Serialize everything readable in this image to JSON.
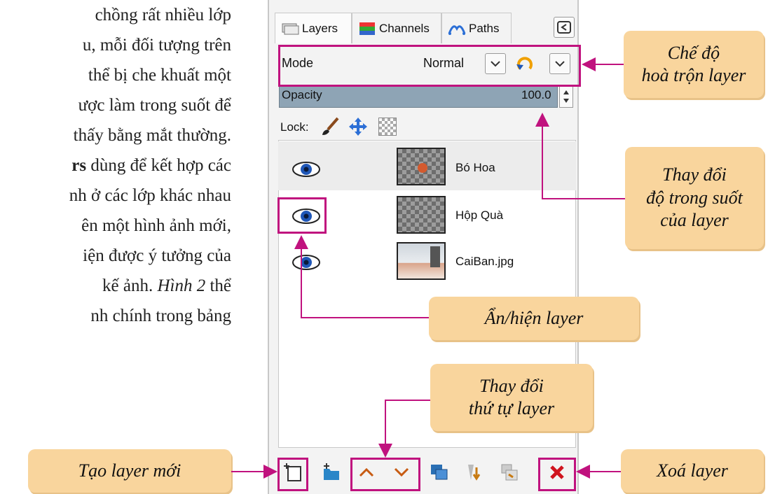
{
  "body_text": {
    "lines": [
      "chồng rất nhiều lớp",
      "u, mỗi đối tượng trên",
      "thể bị che khuất một",
      "ược làm trong suốt để",
      "thấy bằng mắt thường.",
      "dùng để kết hợp các",
      "nh ở các lớp khác nhau",
      "ên một hình ảnh mới,",
      "iện được ý tưởng của",
      "kế ảnh.",
      "nh chính trong bảng"
    ],
    "bold_fragment": "rs",
    "italic_fragment": "Hình 2",
    "line_10_tail": "thể"
  },
  "panel": {
    "tabs": [
      "Layers",
      "Channels",
      "Paths"
    ],
    "mode_label": "Mode",
    "mode_value": "Normal",
    "opacity_label": "Opacity",
    "opacity_value": "100.0",
    "lock_label": "Lock:",
    "layers": [
      {
        "name": "Bó Hoa",
        "visible": true,
        "selected": true
      },
      {
        "name": "Hộp Quà",
        "visible": true,
        "selected": false
      },
      {
        "name": "CaiBan.jpg",
        "visible": true,
        "selected": false
      }
    ],
    "icons": {
      "layers_tab": "layers-icon",
      "channels_tab": "channels-icon",
      "paths_tab": "paths-icon",
      "dock_menu": "dock-menu-icon",
      "chevron": "chevron-down-icon",
      "reset": "reset-icon",
      "lock_pixels": "paintbrush-icon",
      "lock_position": "move-icon",
      "lock_alpha": "checkerboard-icon",
      "eye": "eye-icon",
      "new_layer": "new-layer-icon",
      "new_group": "new-group-icon",
      "raise": "chevron-up-icon",
      "lower": "chevron-down-icon",
      "duplicate": "duplicate-icon",
      "anchor": "anchor-icon",
      "merge": "merge-icon",
      "delete": "delete-icon"
    }
  },
  "annotations": {
    "blend_mode": [
      "Chế độ",
      "hoà trộn layer"
    ],
    "opacity": [
      "Thay đổi",
      "độ trong suốt",
      "của layer"
    ],
    "visibility": [
      "Ẩn/hiện layer"
    ],
    "order": [
      "Thay đổi",
      "thứ tự layer"
    ],
    "new_layer": [
      "Tạo layer mới"
    ],
    "delete_layer": [
      "Xoá layer"
    ]
  },
  "colors": {
    "callout_fill": "#f9d59d",
    "highlight": "#c0127e",
    "opacity_bar": "#8ea4b5",
    "arrow_orange": "#c75b12",
    "delete_red": "#d0141e",
    "eye_blue": "#1f57b8"
  }
}
